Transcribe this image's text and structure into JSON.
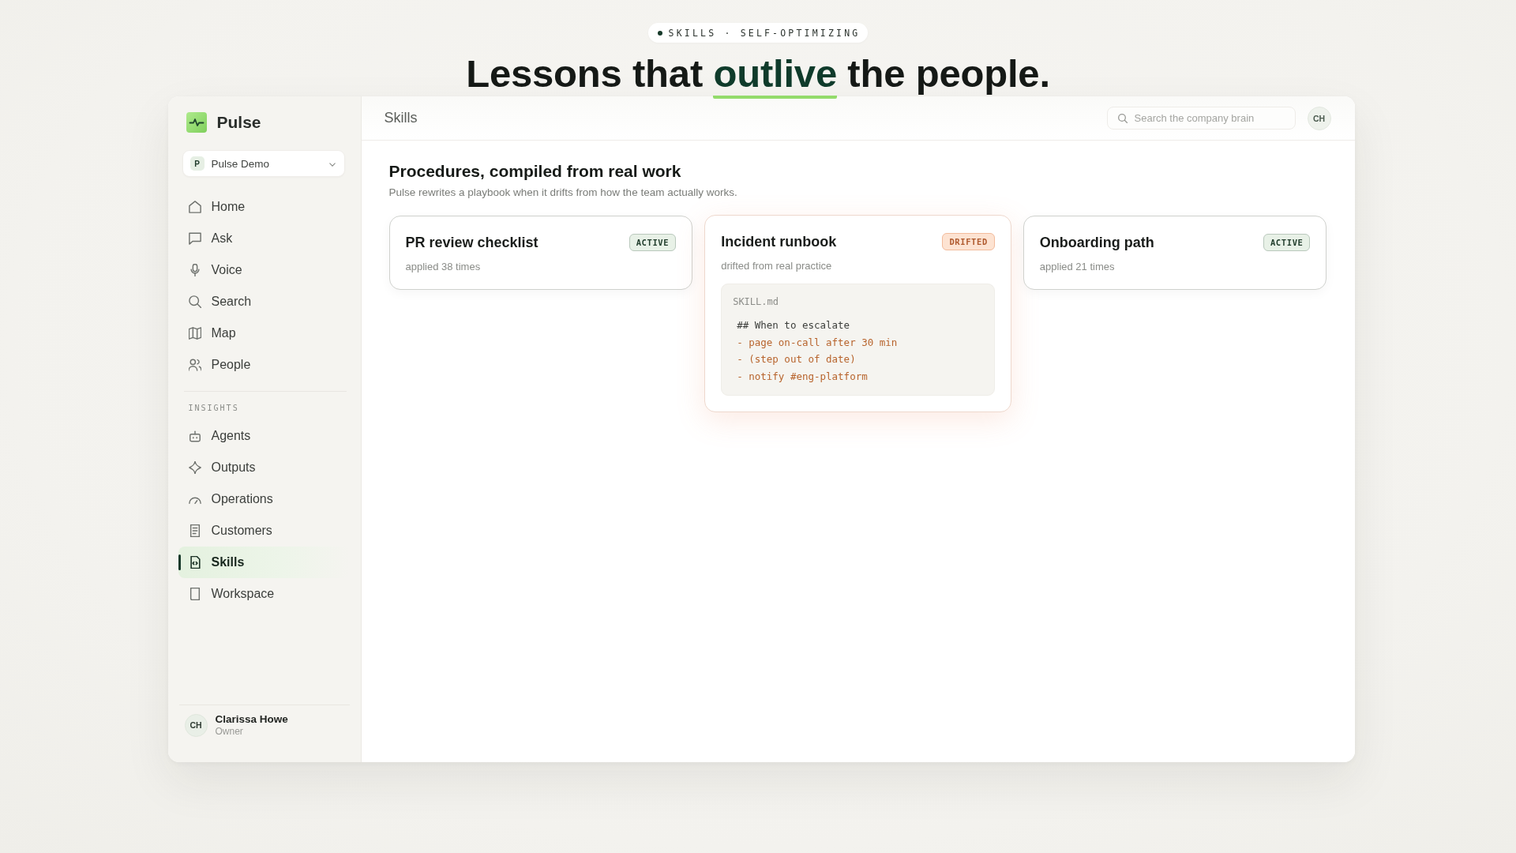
{
  "hero": {
    "eyebrow": "SKILLS · SELF-OPTIMIZING",
    "headline": {
      "before": "Lessons that",
      "highlight": "outlive",
      "after": "the people."
    }
  },
  "sidebar": {
    "brand": "Pulse",
    "workspace": {
      "initial": "P",
      "name": "Pulse Demo"
    },
    "nav": [
      {
        "label": "Home",
        "selected": false
      },
      {
        "label": "Ask",
        "selected": false
      },
      {
        "label": "Voice",
        "selected": false
      },
      {
        "label": "Search",
        "selected": false
      },
      {
        "label": "Map",
        "selected": false
      },
      {
        "label": "People",
        "selected": false
      }
    ],
    "insights": {
      "heading": "INSIGHTS",
      "items": [
        {
          "label": "Agents",
          "selected": false
        },
        {
          "label": "Outputs",
          "selected": false
        },
        {
          "label": "Operations",
          "selected": false
        },
        {
          "label": "Customers",
          "selected": false
        },
        {
          "label": "Skills",
          "selected": true
        },
        {
          "label": "Workspace",
          "selected": false
        }
      ]
    },
    "user": {
      "initials": "CH",
      "name": "Clarissa Howe",
      "role": "Owner"
    }
  },
  "topbar": {
    "title": "Skills",
    "search": {
      "placeholder": "Search the company brain"
    },
    "avatar": "CH"
  },
  "content": {
    "heading": "Procedures, compiled from real work",
    "subheading": "Pulse rewrites a playbook when it drifts from how the team actually works.",
    "cards": [
      {
        "title": "PR review checklist",
        "kind": "active",
        "badge": "ACTIVE",
        "meta": "applied 38 times"
      },
      {
        "title": "Incident runbook",
        "kind": "drifted",
        "badge": "DRIFTED",
        "meta": "drifted from real practice",
        "file": {
          "name": "SKILL.md",
          "lines": [
            {
              "kind": "heading",
              "text": "## When to escalate"
            },
            {
              "kind": "item",
              "text": "- page on-call after 30 min"
            },
            {
              "kind": "item",
              "text": "- (step out of date)"
            },
            {
              "kind": "item",
              "text": "- notify #eng-platform"
            }
          ]
        }
      },
      {
        "title": "Onboarding path",
        "kind": "active",
        "badge": "ACTIVE",
        "meta": "applied 21 times"
      }
    ]
  }
}
